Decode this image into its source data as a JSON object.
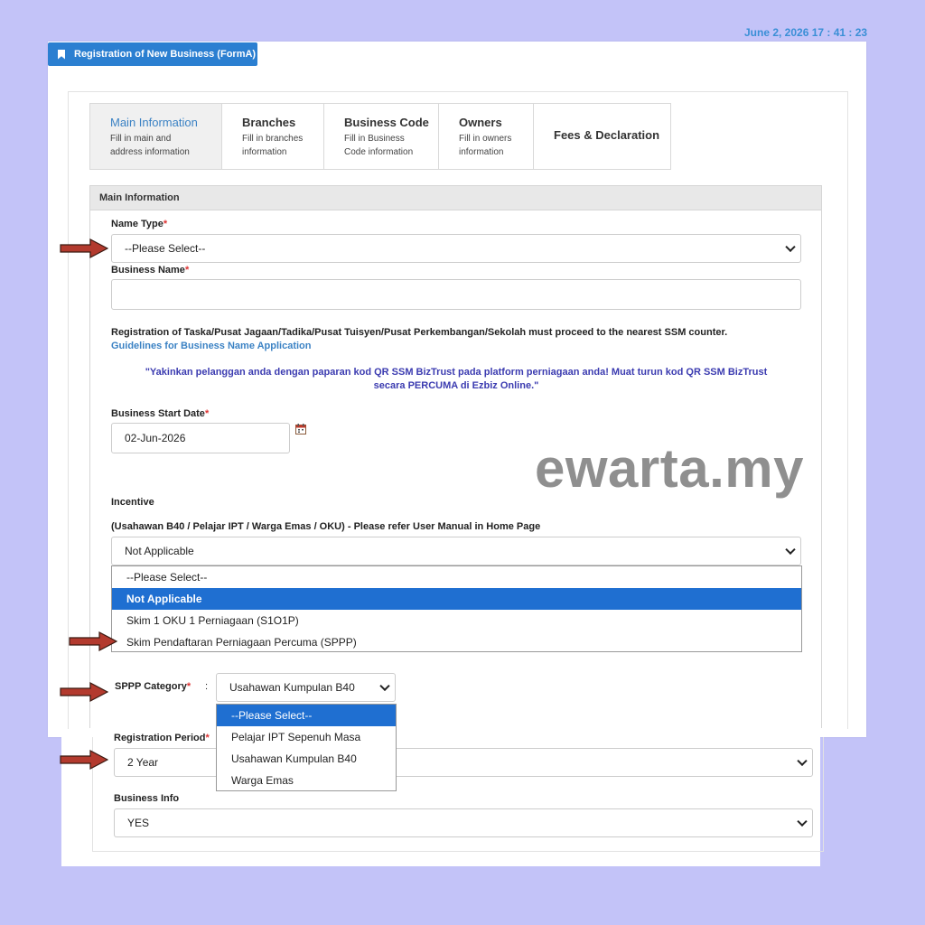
{
  "timestamp": "June 2, 2026 17 : 41 : 23",
  "header_tab": {
    "label": "Registration of New Business (FormA)"
  },
  "steps": [
    {
      "title": "Main Information",
      "desc1": "Fill in main and",
      "desc2": "address information"
    },
    {
      "title": "Branches",
      "desc1": "Fill in branches",
      "desc2": "information"
    },
    {
      "title": "Business Code",
      "desc1": "Fill in Business",
      "desc2": "Code information"
    },
    {
      "title": "Owners",
      "desc1": "Fill in owners",
      "desc2": "information"
    },
    {
      "title": "Fees & Declaration",
      "desc1": "",
      "desc2": ""
    }
  ],
  "section": {
    "title": "Main Information"
  },
  "name_type": {
    "label": "Name Type",
    "required": "*",
    "value": "--Please Select--"
  },
  "business_name": {
    "label": "Business Name",
    "required": "*",
    "value": ""
  },
  "notice": {
    "text": "Registration of Taska/Pusat Jagaan/Tadika/Pusat Tuisyen/Pusat Perkembangan/Sekolah must proceed to the nearest SSM counter.",
    "link": "Guidelines for Business Name Application"
  },
  "promo": {
    "line1": "\"Yakinkan pelanggan anda dengan paparan kod QR SSM BizTrust pada platform perniagaan anda! Muat turun kod QR SSM BizTrust",
    "line2": "secara  PERCUMA di Ezbiz Online.\""
  },
  "start_date": {
    "label": "Business Start Date",
    "required": "*",
    "value": "02-Jun-2026",
    "icon": "calendar-icon"
  },
  "incentive": {
    "label": "Incentive",
    "sublabel": "(Usahawan B40 / Pelajar IPT / Warga Emas / OKU) - Please refer User Manual in Home Page",
    "value": "Not Applicable",
    "options": [
      "--Please Select--",
      "Not Applicable",
      "Skim 1 OKU 1 Perniagaan (S1O1P)",
      "Skim Pendaftaran Perniagaan Percuma (SPPP)"
    ]
  },
  "sppp_category": {
    "label": "SPPP Category",
    "required": "*",
    "colon": ":",
    "value": "Usahawan Kumpulan B40",
    "options": [
      "--Please Select--",
      "Pelajar IPT Sepenuh Masa",
      "Usahawan Kumpulan B40",
      "Warga Emas"
    ]
  },
  "registration_period": {
    "label": "Registration Period",
    "required": "*",
    "value": "2 Year"
  },
  "business_info": {
    "label": "Business Info",
    "value": "YES"
  },
  "watermark": "ewarta.my",
  "colors": {
    "background": "#c3c3f8",
    "accent": "#2b7fd1",
    "selected_option": "#1f6fd1",
    "arrow": "#b33a2e",
    "required": "#dd3333"
  }
}
